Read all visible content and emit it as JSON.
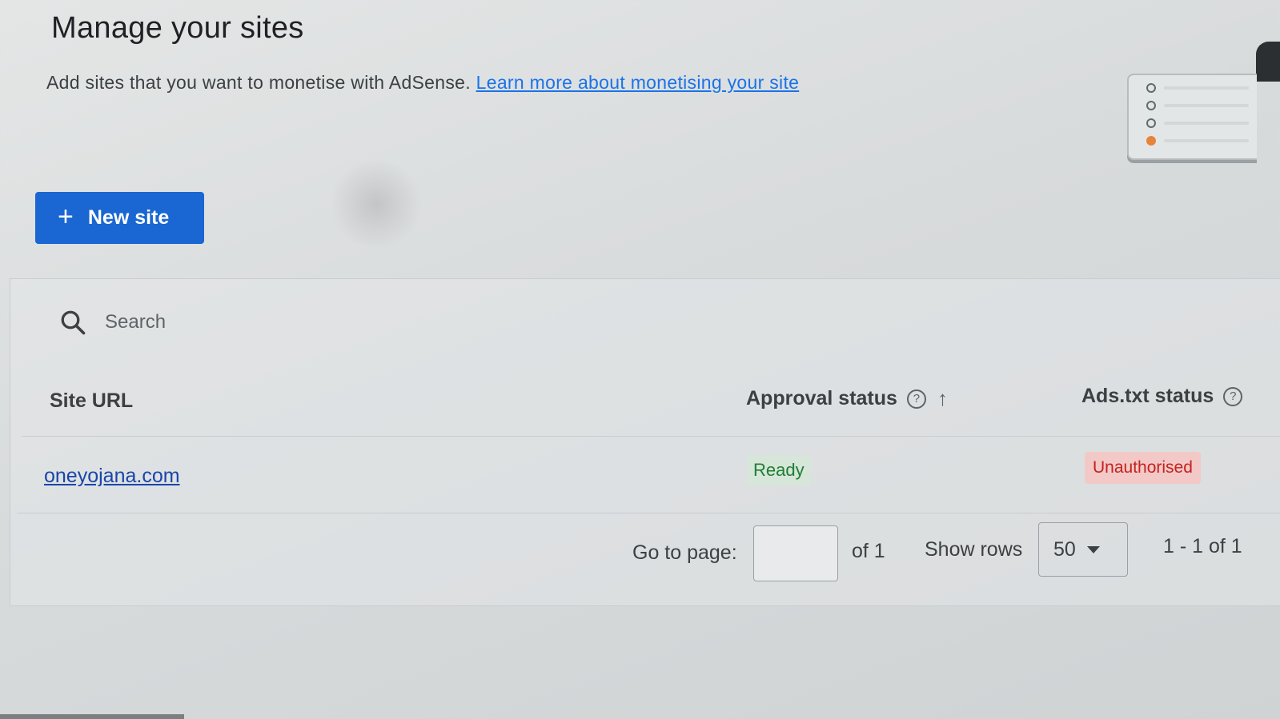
{
  "page": {
    "title": "Manage your sites",
    "subtitle_text": "Add sites that you want to monetise with AdSense.",
    "learn_more_link": "Learn more about monetising your site"
  },
  "actions": {
    "new_site_label": "New site"
  },
  "search": {
    "placeholder": "Search"
  },
  "table": {
    "columns": {
      "site_url": "Site URL",
      "approval_status": "Approval status",
      "ads_txt_status": "Ads.txt status"
    },
    "rows": [
      {
        "site_url": "oneyojana.com",
        "approval_status": "Ready",
        "ads_txt_status": "Unauthorised"
      }
    ]
  },
  "pagination": {
    "go_to_page_label": "Go to page:",
    "page_count": "of 1",
    "show_rows_label": "Show rows",
    "rows_per_page": "50",
    "range_text": "1 - 1 of 1"
  },
  "colors": {
    "primary_button": "#1a66d2",
    "link": "#1a73e8",
    "ready_chip_bg": "#d6e6d9",
    "ready_chip_text": "#1e7e34",
    "unauthorised_chip_bg": "#f2c9c6",
    "unauthorised_chip_text": "#c5221f"
  },
  "icons": {
    "new_site": "plus-icon",
    "search": "search-icon",
    "help": "help-circle-icon",
    "sort": "arrow-up-icon",
    "rows_dropdown": "caret-down-icon"
  }
}
